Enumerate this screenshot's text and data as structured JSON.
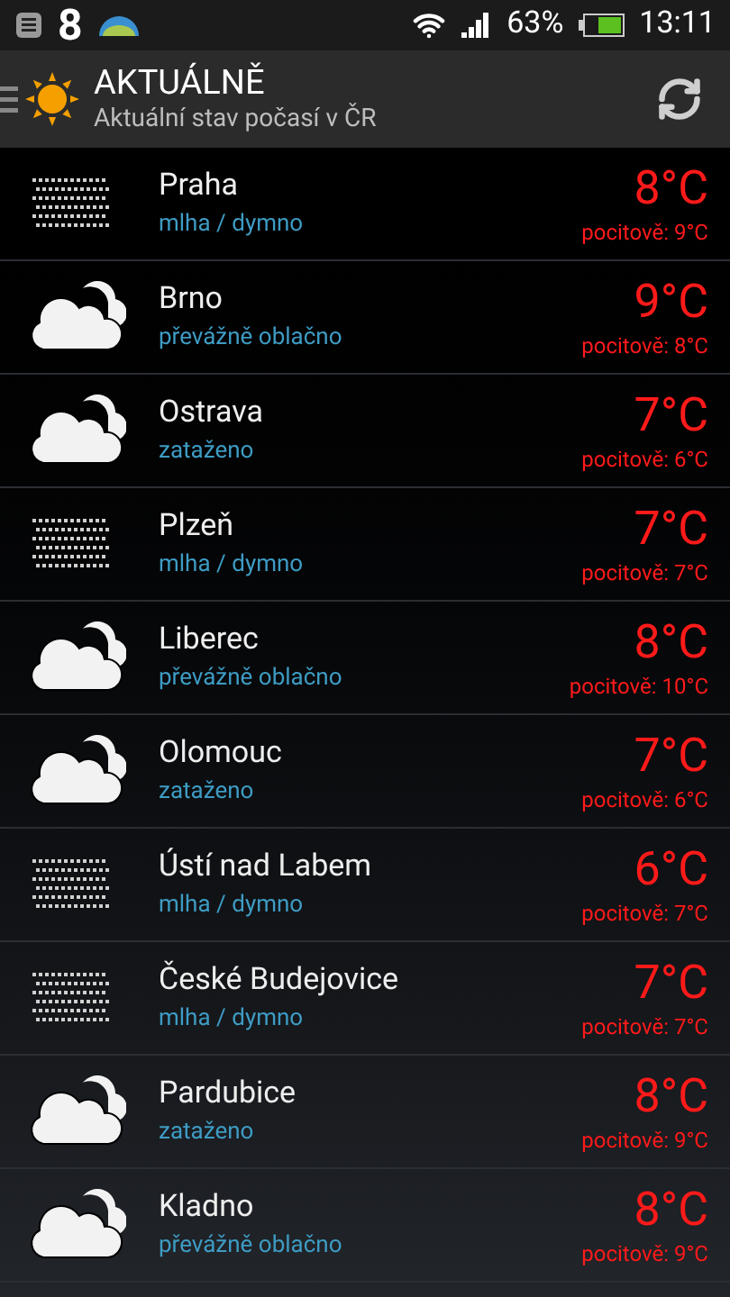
{
  "status_bar": {
    "notification_count": "8",
    "battery": "63%",
    "time": "13:11"
  },
  "app_bar": {
    "title": "AKTUÁLNĚ",
    "subtitle": "Aktuální stav počasí v ČR"
  },
  "cities": [
    {
      "name": "Praha",
      "condition": "mlha / dymno",
      "kind": "fog",
      "temperature": "8°C",
      "feels_like": "pocitově: 9°C"
    },
    {
      "name": "Brno",
      "condition": "převážně oblačno",
      "kind": "cloud",
      "temperature": "9°C",
      "feels_like": "pocitově: 8°C"
    },
    {
      "name": "Ostrava",
      "condition": "zataženo",
      "kind": "cloud",
      "temperature": "7°C",
      "feels_like": "pocitově: 6°C"
    },
    {
      "name": "Plzeň",
      "condition": "mlha / dymno",
      "kind": "fog",
      "temperature": "7°C",
      "feels_like": "pocitově: 7°C"
    },
    {
      "name": "Liberec",
      "condition": "převážně oblačno",
      "kind": "cloud",
      "temperature": "8°C",
      "feels_like": "pocitově: 10°C"
    },
    {
      "name": "Olomouc",
      "condition": "zataženo",
      "kind": "cloud",
      "temperature": "7°C",
      "feels_like": "pocitově: 6°C"
    },
    {
      "name": "Ústí nad Labem",
      "condition": "mlha / dymno",
      "kind": "fog",
      "temperature": "6°C",
      "feels_like": "pocitově: 7°C"
    },
    {
      "name": "České Budejovice",
      "condition": "mlha / dymno",
      "kind": "fog",
      "temperature": "7°C",
      "feels_like": "pocitově: 7°C"
    },
    {
      "name": "Pardubice",
      "condition": "zataženo",
      "kind": "cloud",
      "temperature": "8°C",
      "feels_like": "pocitově: 9°C"
    },
    {
      "name": "Kladno",
      "condition": "převážně oblačno",
      "kind": "cloud",
      "temperature": "8°C",
      "feels_like": "pocitově: 9°C"
    }
  ]
}
